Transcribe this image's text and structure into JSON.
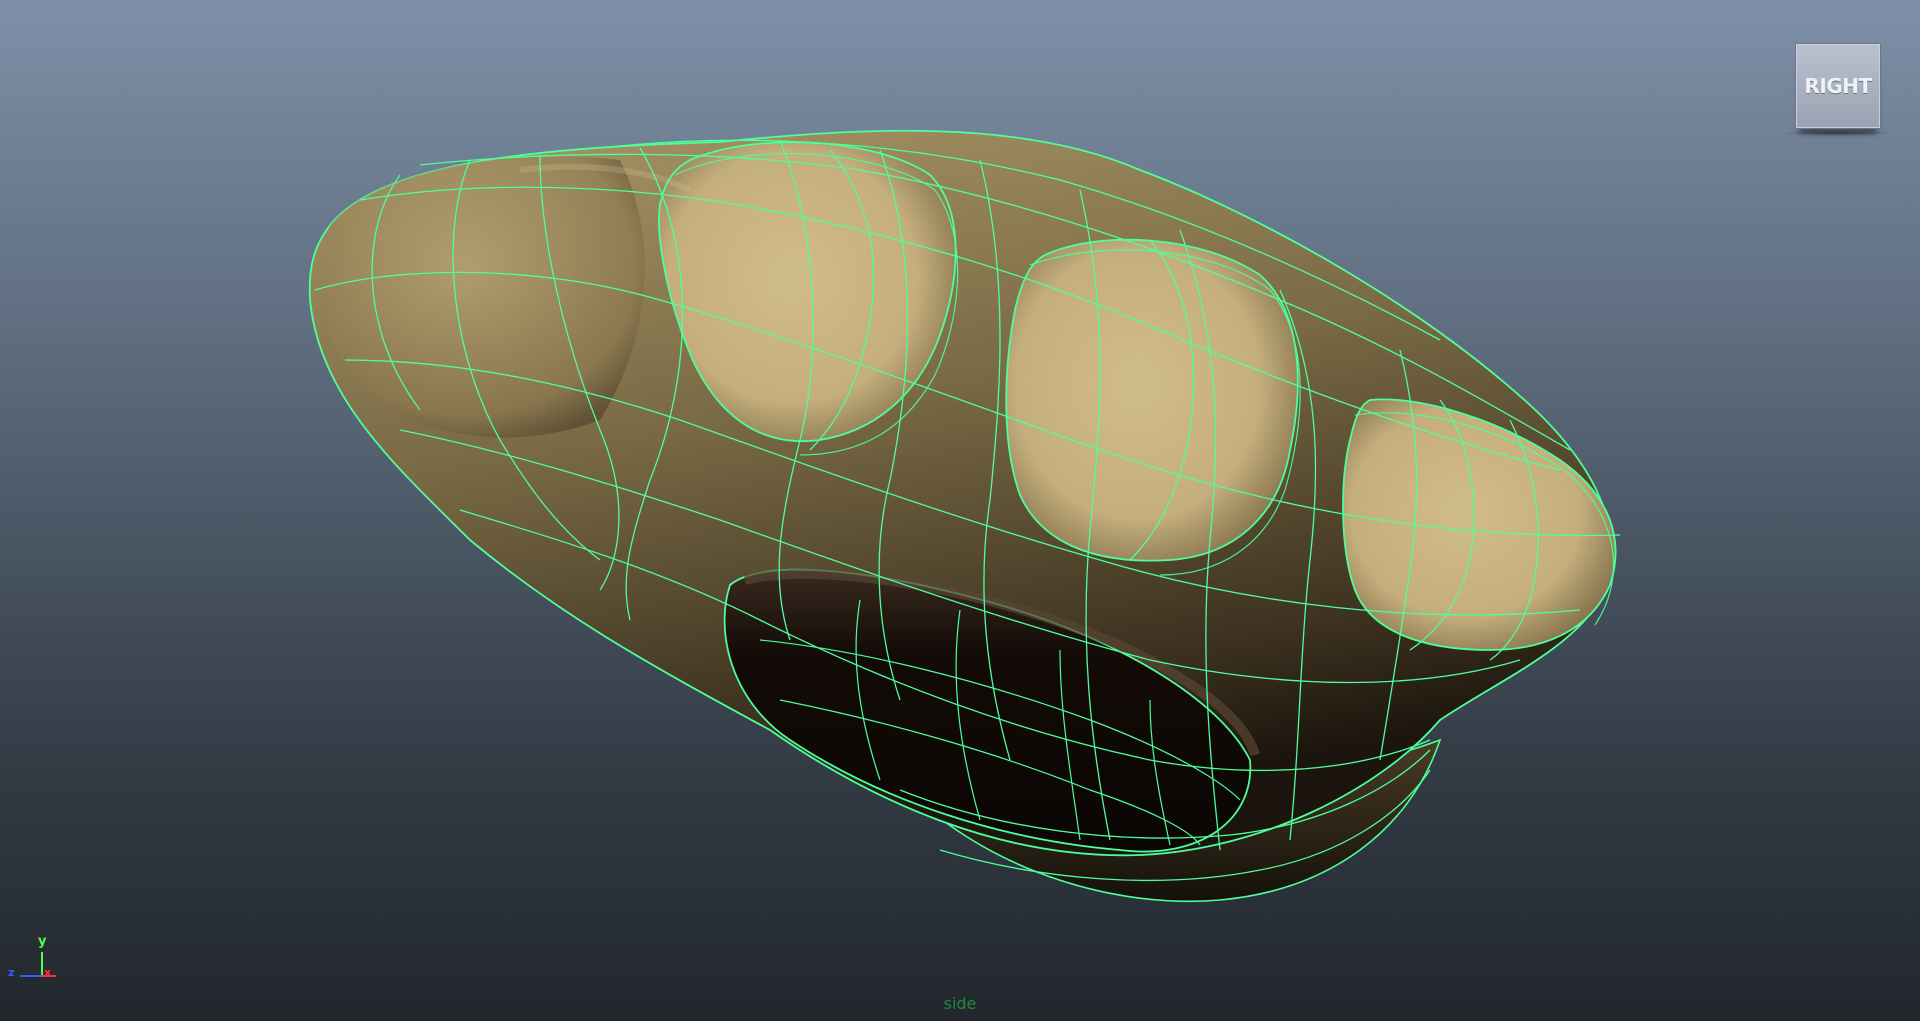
{
  "viewport": {
    "camera_name": "side",
    "view_cube_label": "RIGHT",
    "axis_labels": {
      "y": "y",
      "x": "x",
      "z": "z"
    },
    "colors": {
      "wireframe": "#4dff9a",
      "surface_light": "#c9b584",
      "surface_dark": "#1a120c",
      "camera_name": "#1f8a3a",
      "axis_y": "#4cff4c",
      "axis_x": "#ff3030",
      "axis_z": "#3a5cff"
    }
  }
}
